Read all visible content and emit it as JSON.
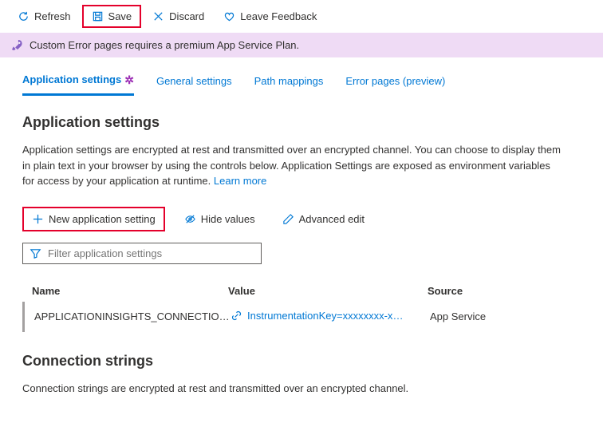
{
  "toolbar": {
    "refresh": "Refresh",
    "save": "Save",
    "discard": "Discard",
    "feedback": "Leave Feedback"
  },
  "banner": {
    "text": "Custom Error pages requires a premium App Service Plan."
  },
  "tabs": {
    "app_settings": "Application settings",
    "general_settings": "General settings",
    "path_mappings": "Path mappings",
    "error_pages": "Error pages (preview)"
  },
  "appSettings": {
    "heading": "Application settings",
    "description": "Application settings are encrypted at rest and transmitted over an encrypted channel. You can choose to display them in plain text in your browser by using the controls below. Application Settings are exposed as environment variables for access by your application at runtime. ",
    "learn_more": "Learn more",
    "new_setting": "New application setting",
    "hide_values": "Hide values",
    "advanced_edit": "Advanced edit",
    "filter_placeholder": "Filter application settings",
    "columns": {
      "name": "Name",
      "value": "Value",
      "source": "Source"
    },
    "rows": [
      {
        "name": "APPLICATIONINSIGHTS_CONNECTION_STRING",
        "value": "InstrumentationKey=xxxxxxxx-xxxx-xxxx",
        "source": "App Service"
      }
    ]
  },
  "connectionStrings": {
    "heading": "Connection strings",
    "description": "Connection strings are encrypted at rest and transmitted over an encrypted channel."
  }
}
